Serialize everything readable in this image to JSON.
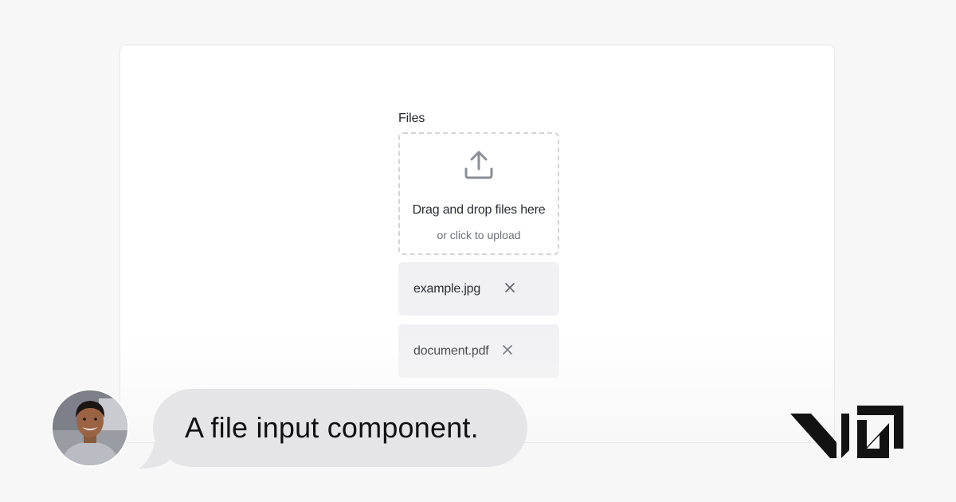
{
  "file_input": {
    "label": "Files",
    "dropzone": {
      "title": "Drag and drop files here",
      "subtitle": "or click to upload",
      "icon": "upload-icon"
    },
    "files": [
      {
        "name": "example.jpg",
        "remove_icon": "close-icon"
      },
      {
        "name": "document.pdf",
        "remove_icon": "close-icon"
      }
    ]
  },
  "chat": {
    "message": "A file input component."
  },
  "brand": {
    "logo": "v0-logo"
  },
  "colors": {
    "page_background": "#f7f7f7",
    "card_background": "#ffffff",
    "dropzone_border": "#d2d4d8",
    "file_item_background": "#f1f1f3",
    "bubble_background": "#e5e5e7",
    "text_primary": "#2a2d33",
    "text_muted": "#6b7079"
  }
}
